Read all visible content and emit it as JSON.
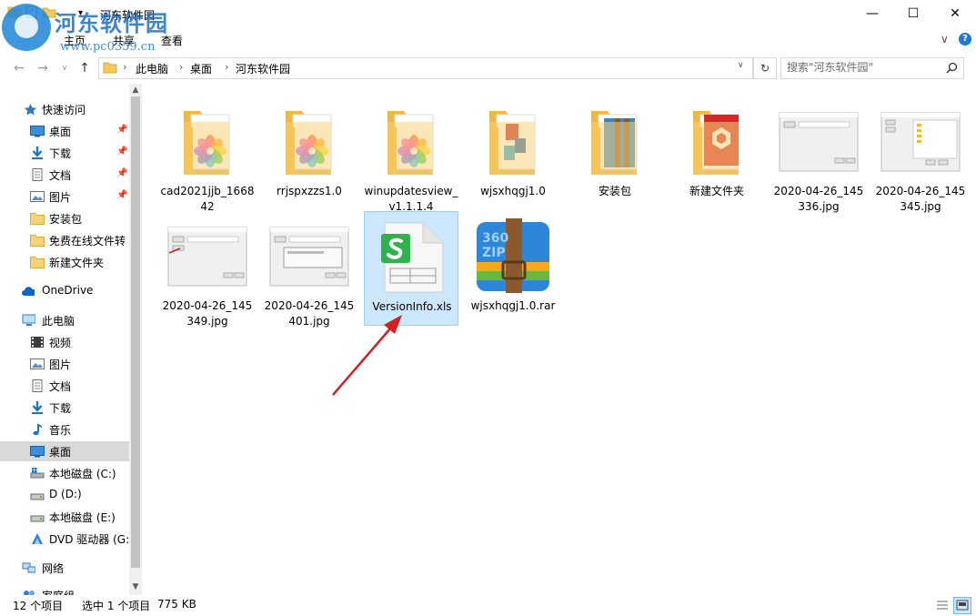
{
  "window": {
    "title": "河东软件园",
    "minimize": "—",
    "maximize": "☐",
    "close": "✕"
  },
  "watermark": {
    "name": "河东软件园",
    "url": "www.pc0359.cn"
  },
  "ribbon": {
    "tabs": [
      "文件",
      "主页",
      "共享",
      "查看"
    ],
    "expand": "∨",
    "help": "?"
  },
  "address": {
    "crumbs": [
      "此电脑",
      "桌面",
      "河东软件园"
    ],
    "dropdown": "∨",
    "refresh": "↻"
  },
  "search": {
    "placeholder": "搜索\"河东软件园\""
  },
  "sidebar": {
    "quick_access": "快速访问",
    "quick_items": [
      {
        "label": "桌面",
        "icon": "desktop-icon",
        "pinned": true
      },
      {
        "label": "下载",
        "icon": "download-icon",
        "pinned": true
      },
      {
        "label": "文档",
        "icon": "document-icon",
        "pinned": true
      },
      {
        "label": "图片",
        "icon": "picture-icon",
        "pinned": true
      },
      {
        "label": "安装包",
        "icon": "folder-icon",
        "pinned": false
      },
      {
        "label": "免费在线文件转",
        "icon": "folder-icon",
        "pinned": false
      },
      {
        "label": "新建文件夹",
        "icon": "folder-icon",
        "pinned": false
      }
    ],
    "onedrive": "OneDrive",
    "this_pc": "此电脑",
    "pc_items": [
      {
        "label": "视频",
        "icon": "video-icon"
      },
      {
        "label": "图片",
        "icon": "picture-icon"
      },
      {
        "label": "文档",
        "icon": "document-icon"
      },
      {
        "label": "下载",
        "icon": "download-icon"
      },
      {
        "label": "音乐",
        "icon": "music-icon"
      },
      {
        "label": "桌面",
        "icon": "desktop-icon",
        "selected": true
      },
      {
        "label": "本地磁盘 (C:)",
        "icon": "system-drive-icon"
      },
      {
        "label": "D (D:)",
        "icon": "drive-icon"
      },
      {
        "label": "本地磁盘 (E:)",
        "icon": "drive-icon"
      },
      {
        "label": "DVD 驱动器 (G:",
        "icon": "dvd-drive-icon"
      }
    ],
    "network": "网络",
    "homegroup": "家庭组"
  },
  "files": [
    {
      "name": "cad2021jjb_166842",
      "type": "folder-app"
    },
    {
      "name": "rrjspxzzs1.0",
      "type": "folder-app"
    },
    {
      "name": "winupdatesview_v1.1.1.4",
      "type": "folder-app"
    },
    {
      "name": "wjsxhqgj1.0",
      "type": "folder-m"
    },
    {
      "name": "安装包",
      "type": "folder-archive"
    },
    {
      "name": "新建文件夹",
      "type": "folder-unity"
    },
    {
      "name": "2020-04-26_145336.jpg",
      "type": "image"
    },
    {
      "name": "2020-04-26_145345.jpg",
      "type": "image-tree"
    },
    {
      "name": "2020-04-26_145349.jpg",
      "type": "image-red"
    },
    {
      "name": "2020-04-26_145401.jpg",
      "type": "image-dialog"
    },
    {
      "name": "VersionInfo.xls",
      "type": "xls",
      "selected": true
    },
    {
      "name": "wjsxhqgj1.0.rar",
      "type": "rar"
    }
  ],
  "status": {
    "count": "12 个项目",
    "selection": "选中 1 个项目",
    "size": "775 KB"
  },
  "colors": {
    "selection": "#cce8ff",
    "accent": "#0078d7",
    "arrow": "#d21f1f"
  }
}
